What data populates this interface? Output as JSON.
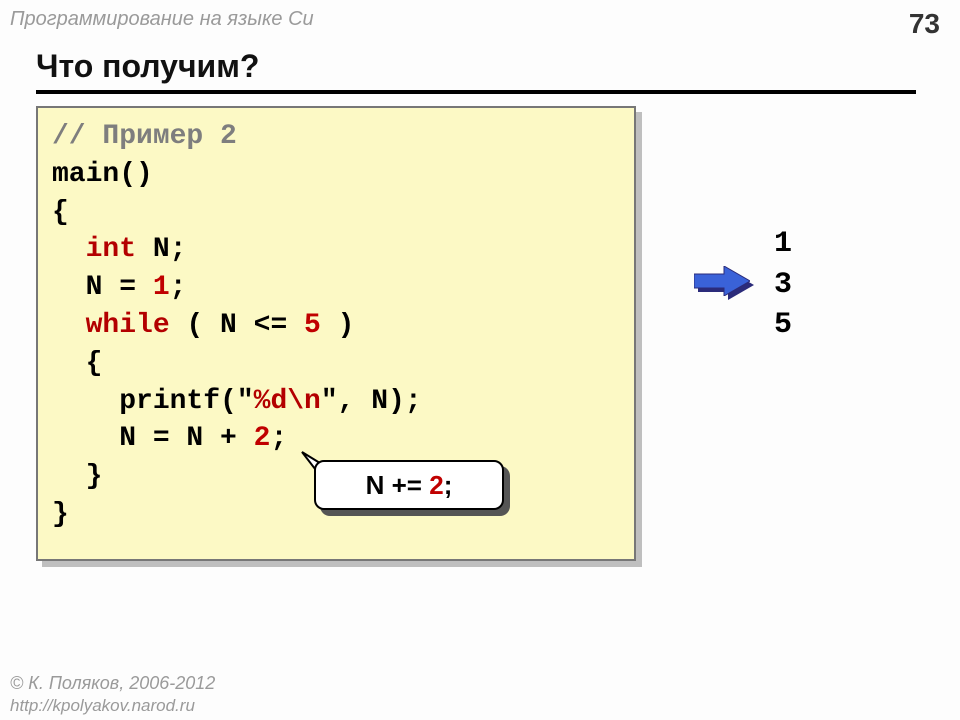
{
  "header": "Программирование на языке Си",
  "page_number": "73",
  "title": "Что получим?",
  "code": {
    "comment": "// Пример 2",
    "l2": "main()",
    "l3": "{",
    "l4a": "  ",
    "l4_kw": "int",
    "l4b": " N;",
    "l5a": "  N = ",
    "l5_num": "1",
    "l5b": ";",
    "l6a": "  ",
    "l6_kw": "while",
    "l6b": " ( N <= ",
    "l6_num": "5",
    "l6c": " )",
    "l7": "  {",
    "l8a": "    printf(\"",
    "l8_str": "%d\\n",
    "l8b": "\", N);",
    "l9a": "    N = N + ",
    "l9_num": "2",
    "l9b": ";",
    "l10": "  }",
    "l11": "}"
  },
  "callout": {
    "prefix": "N += ",
    "num": "2",
    "suffix": ";"
  },
  "output": "1\n3\n5",
  "footer": {
    "author": "© К. Поляков, 2006-2012",
    "url": "http://kpolyakov.narod.ru"
  }
}
